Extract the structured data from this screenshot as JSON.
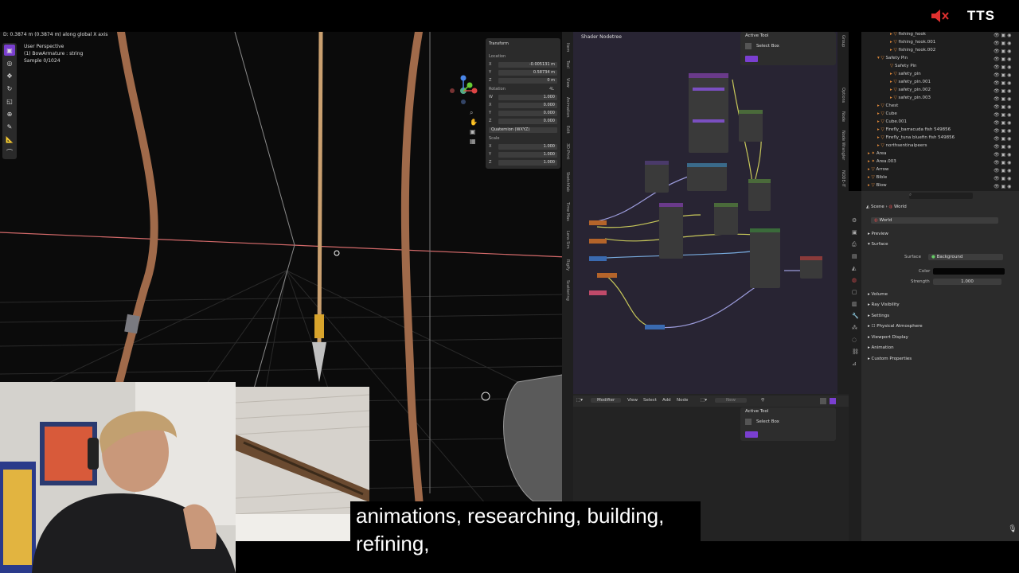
{
  "topbar": {
    "brand": "TTS",
    "mute_icon": "speaker-muted-icon",
    "accent": "#e0302f"
  },
  "viewport": {
    "status": "D: 0.3874 m (0.3874 m) along global X axis",
    "perspective": "User Perspective",
    "object": "(1) BowArmature : string",
    "sample": "Sample 0/1024",
    "side_tabs": [
      "Item",
      "Tool",
      "View",
      "Animation",
      "Edit",
      "3D-Print",
      "Sketchfab",
      "Time Mas",
      "Lens Sim",
      "Rigify",
      "Scattering"
    ],
    "tools": [
      "select-box-icon",
      "cursor-icon",
      "move-icon",
      "rotate-icon",
      "scale-icon",
      "transform-icon",
      "annotate-icon",
      "measure-icon",
      "add-icon"
    ]
  },
  "npanel": {
    "title": "Transform",
    "location_label": "Location",
    "location": [
      {
        "axis": "X",
        "value": "-0.005131 m"
      },
      {
        "axis": "Y",
        "value": "0.58734 m"
      },
      {
        "axis": "Z",
        "value": "0 m"
      }
    ],
    "rotation_label": "Rotation",
    "rotation_mode_tag": "4L",
    "rotation": [
      {
        "axis": "W",
        "value": "1.000"
      },
      {
        "axis": "X",
        "value": "0.000"
      },
      {
        "axis": "Y",
        "value": "0.000"
      },
      {
        "axis": "Z",
        "value": "0.000"
      }
    ],
    "rotation_mode": "Quaternion (WXYZ)",
    "scale_label": "Scale",
    "scale": [
      {
        "axis": "X",
        "value": "1.000"
      },
      {
        "axis": "Y",
        "value": "1.000"
      },
      {
        "axis": "Z",
        "value": "1.000"
      }
    ]
  },
  "shader": {
    "title": "Shader Nodetree",
    "active_tool_label": "Active Tool",
    "select_box": "Select Box",
    "side_tabs": [
      "Group",
      "Options",
      "Node",
      "Node Wrangler",
      "NODE-IT"
    ]
  },
  "lower_editor": {
    "mode": "Modifier",
    "menus": [
      "View",
      "Select",
      "Add",
      "Node"
    ],
    "new_label": "New",
    "active_tool_label": "Active Tool",
    "select_box": "Select Box"
  },
  "outliner": {
    "rows": [
      {
        "name": "fishing_hook",
        "indent": 3
      },
      {
        "name": "fishing_hook.001",
        "indent": 3
      },
      {
        "name": "fishing_hook.002",
        "indent": 3
      },
      {
        "name": "Safety Pin",
        "indent": 2
      },
      {
        "name": "Safety Pin",
        "indent": 3
      },
      {
        "name": "safety_pin",
        "indent": 3
      },
      {
        "name": "safety_pin.001",
        "indent": 3
      },
      {
        "name": "safety_pin.002",
        "indent": 3
      },
      {
        "name": "safety_pin.003",
        "indent": 3
      },
      {
        "name": "Chest",
        "indent": 2
      },
      {
        "name": "Cube",
        "indent": 2
      },
      {
        "name": "Cube.001",
        "indent": 2
      },
      {
        "name": "Firefly_barracuda fish 549856",
        "indent": 2
      },
      {
        "name": "Firefly_tuna bluefin fish 549856",
        "indent": 2
      },
      {
        "name": "northsentinalpeers",
        "indent": 2
      },
      {
        "name": "Area",
        "indent": 1
      },
      {
        "name": "Area.003",
        "indent": 1
      },
      {
        "name": "Arrow",
        "indent": 1
      },
      {
        "name": "Bible",
        "indent": 1
      },
      {
        "name": "Blow",
        "indent": 1
      }
    ],
    "search_placeholder": ""
  },
  "properties": {
    "breadcrumb_scene": "Scene",
    "breadcrumb_world": "World",
    "world_name": "World",
    "preview": "Preview",
    "surface": "Surface",
    "surface_label": "Surface",
    "surface_value": "Background",
    "color_label": "Color",
    "strength_label": "Strength",
    "strength_value": "1.000",
    "sections": [
      "Volume",
      "Ray Visibility",
      "Settings",
      "Physical Atmosphere",
      "Viewport Display",
      "Animation",
      "Custom Properties"
    ]
  },
  "caption": {
    "line1": "animations, researching, building,",
    "line2": "refining,"
  }
}
